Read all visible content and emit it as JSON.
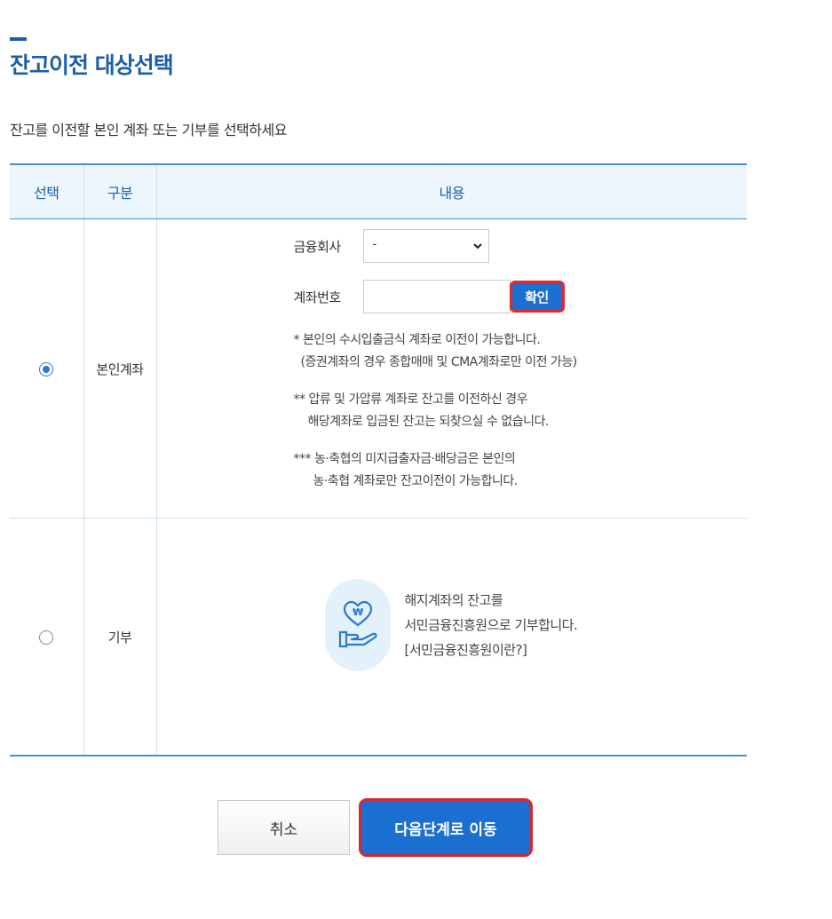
{
  "page": {
    "title": "잔고이전 대상선택",
    "instruction": "잔고를 이전할 본인 계좌 또는 기부를 선택하세요"
  },
  "colors": {
    "accent": "#1a5fa8",
    "button_blue": "#1a6fd0",
    "highlight_red": "#e8262c",
    "header_bg": "#eef6fd"
  },
  "table": {
    "headers": {
      "select": "선택",
      "category": "구분",
      "content": "내용"
    },
    "rows": {
      "self": {
        "selected": true,
        "category": "본인계좌",
        "bank_label": "금융회사",
        "bank_value": "-",
        "account_label": "계좌번호",
        "account_value": "",
        "confirm_label": "확인",
        "note1_line1": "* 본인의 수시입출금식 계좌로 이전이 가능합니다.",
        "note1_line2": "(증권계좌의 경우 종합매매 및 CMA계좌로만 이전 가능)",
        "note2_line1": "** 압류 및 가압류 계좌로 잔고를 이전하신 경우",
        "note2_line2": "해당계좌로 입금된 잔고는 되찾으실 수 없습니다.",
        "note3_line1": "*** 농·축협의 미지급출자금·배당금은 본인의",
        "note3_line2": "농·축협 계좌로만 잔고이전이 가능합니다."
      },
      "donate": {
        "selected": false,
        "category": "기부",
        "icon": "heart-won-hand-icon",
        "text_line1": "해지계좌의 잔고를",
        "text_line2": "서민금융진흥원으로 기부합니다.",
        "link_label": "[서민금융진흥원이란?]"
      }
    }
  },
  "buttons": {
    "cancel": "취소",
    "next": "다음단계로 이동"
  }
}
